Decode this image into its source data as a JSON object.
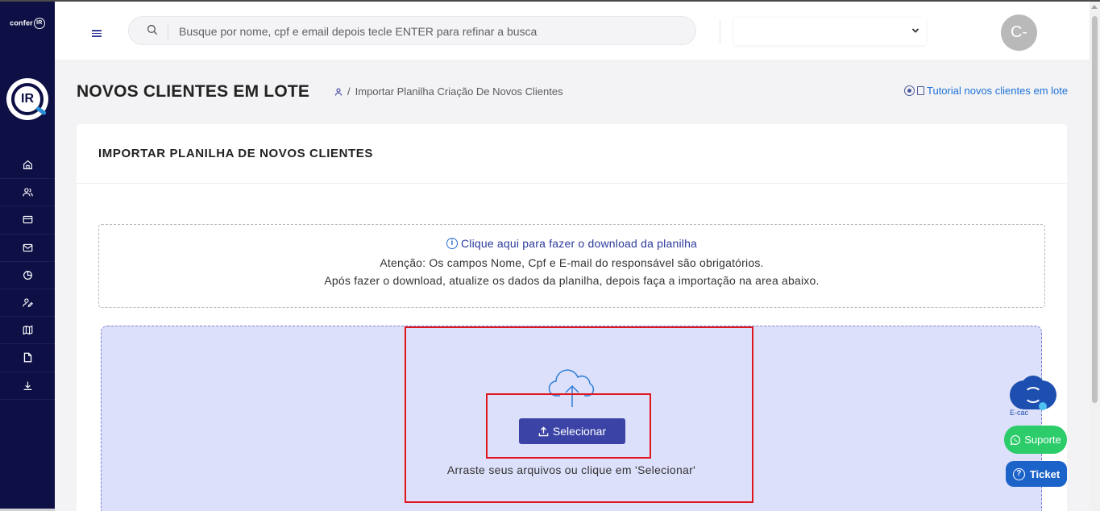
{
  "brand": {
    "name": "confer",
    "mark": "IR",
    "logo_text": "IR"
  },
  "sidebar": {
    "items": [
      {
        "name": "home"
      },
      {
        "name": "users"
      },
      {
        "name": "card"
      },
      {
        "name": "mail"
      },
      {
        "name": "chart"
      },
      {
        "name": "user-edit"
      },
      {
        "name": "book"
      },
      {
        "name": "file"
      },
      {
        "name": "download"
      }
    ]
  },
  "header": {
    "search_placeholder": "Busque por nome, cpf e email depois tecle ENTER para refinar a busca",
    "select_value": "",
    "avatar_initials": "C-"
  },
  "page": {
    "title": "NOVOS CLIENTES EM LOTE",
    "breadcrumb": "Importar Planilha Criação De Novos Clientes",
    "tutorial_link": "Tutorial novos clientes em lote"
  },
  "card": {
    "title": "IMPORTAR PLANILHA DE NOVOS CLIENTES",
    "download_link": "Clique aqui para fazer o download da planilha",
    "attention": "Atenção: Os campos Nome, Cpf e E-mail do responsável são obrigatórios.",
    "instructions": "Após fazer o download, atualize os dados da planilha, depois faça a importação na area abaixo.",
    "select_button": "Selecionar",
    "drop_text": "Arraste seus arquivos ou clique em 'Selecionar'"
  },
  "widgets": {
    "ecac_label": "E-cac",
    "suporte_label": "Suporte",
    "ticket_label": "Ticket"
  },
  "colors": {
    "sidebar_bg": "#0d0f45",
    "primary": "#3b44a6",
    "dropzone_bg": "#dde0fa",
    "highlight": "#e0161e",
    "whatsapp": "#2dcc6b",
    "ticket": "#1c63c9"
  }
}
